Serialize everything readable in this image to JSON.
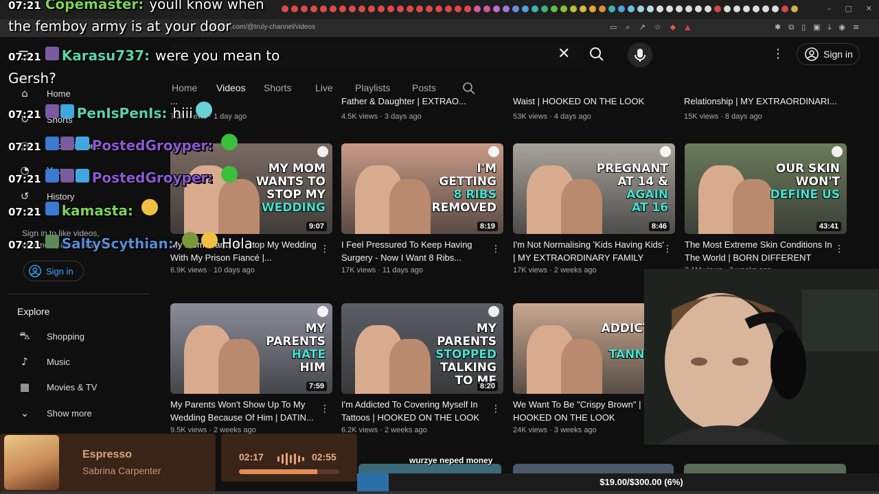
{
  "browser": {
    "url": "youtube.com/@truly-channel/videos",
    "tab_dot_colors": [
      "#e04848",
      "#e04848",
      "#e04848",
      "#e04848",
      "#e04848",
      "#e04848",
      "#e04848",
      "#e04848",
      "#e04848",
      "#e04848",
      "#e04848",
      "#e04848",
      "#e04848",
      "#e04848",
      "#e04848",
      "#e04848",
      "#e04848",
      "#e04848",
      "#e04848",
      "#e04848",
      "#d05a9a",
      "#d05a9a",
      "#c76bd0",
      "#9b7ad6",
      "#6b8be0",
      "#4fa0d8",
      "#3fb0b0",
      "#3fb07a",
      "#5fbf4a",
      "#8ac23b",
      "#b7c03a",
      "#d8b93b",
      "#e0a53b",
      "#e08a3b",
      "#3fb0b0",
      "#4fa0d8",
      "#6bc0e0",
      "#9bd0e0",
      "#c0d8e0",
      "#dcdcdc",
      "#dcdcdc",
      "#dcdcdc",
      "#dcdcdc",
      "#dcdcdc",
      "#dcdcdc",
      "#d04848",
      "#dcdcdc",
      "#dcdcdc",
      "#dcdcdc",
      "#dcdcdc",
      "#dcdcdc",
      "#dcdcdc",
      "#d04848",
      "#d0b04a"
    ]
  },
  "header": {
    "search_value": "",
    "signin_label": "Sign in"
  },
  "channel_tabs": [
    {
      "label": "Home",
      "active": false
    },
    {
      "label": "Videos",
      "active": true
    },
    {
      "label": "Shorts",
      "active": false
    },
    {
      "label": "Live",
      "active": false
    },
    {
      "label": "Playlists",
      "active": false
    },
    {
      "label": "Posts",
      "active": false
    }
  ],
  "sidebar": {
    "items": [
      {
        "label": "Home",
        "icon": "home-icon"
      },
      {
        "label": "Shorts",
        "icon": "shorts-icon"
      },
      {
        "label": "Subscriptions",
        "icon": "subscriptions-icon"
      },
      {
        "label": "You",
        "icon": "you-icon"
      },
      {
        "label": "History",
        "icon": "history-icon"
      }
    ],
    "signin_prompt": "Sign in to like videos, comment, and subscribe.",
    "signin_label": "Sign in",
    "explore_title": "Explore",
    "explore_items": [
      {
        "label": "Shopping",
        "icon": "shopping-bag-icon"
      },
      {
        "label": "Music",
        "icon": "music-note-icon"
      },
      {
        "label": "Movies & TV",
        "icon": "film-icon"
      },
      {
        "label": "Show more",
        "icon": "chevron-down-icon"
      }
    ]
  },
  "partial_row": [
    {
      "title": "...",
      "meta": "7.2K views · 1 day ago"
    },
    {
      "title": "Father & Daughter | EXTRAO...",
      "meta": "4.5K views · 3 days ago"
    },
    {
      "title": "Waist | HOOKED ON THE LOOK",
      "meta": "53K views · 4 days ago"
    },
    {
      "title": "Relationship | MY EXTRAORDINARI...",
      "meta": "15K views · 8 days ago"
    }
  ],
  "videos": [
    {
      "thumb_text": [
        "MY MOM",
        "WANTS TO",
        "STOP MY",
        "WEDDING"
      ],
      "hl": [
        3
      ],
      "duration": "9:07",
      "title": "My Mom Wants To Stop My Wedding With My Prison Fiancé |...",
      "meta": "6.9K views · 10 days ago",
      "bg": "#7a6b62"
    },
    {
      "thumb_text": [
        "I'M",
        "GETTING",
        "8 RIBS",
        "REMOVED"
      ],
      "hl": [
        2
      ],
      "duration": "8:19",
      "title": "I Feel Pressured To Keep Having Surgery - Now I Want 8 Ribs...",
      "meta": "17K views · 11 days ago",
      "bg": "#c99a86"
    },
    {
      "thumb_text": [
        "PREGNANT",
        "AT 14 &",
        "AGAIN",
        "AT 16"
      ],
      "hl": [
        2,
        3
      ],
      "duration": "8:46",
      "title": "I'm Not Normalising 'Kids Having Kids' | MY EXTRAORDINARY FAMILY",
      "meta": "17K views · 2 weeks ago",
      "bg": "#a8a39a"
    },
    {
      "thumb_text": [
        "OUR SKIN",
        "WON'T",
        "DEFINE US"
      ],
      "hl": [
        2
      ],
      "duration": "43:41",
      "title": "The Most Extreme Skin Conditions In The World | BORN DIFFERENT",
      "meta": "2.1M views · 3 weeks ago",
      "bg": "#6a7b5a"
    },
    {
      "thumb_text": [
        "MY",
        "PARENTS",
        "HATE",
        "HIM"
      ],
      "hl": [
        2
      ],
      "duration": "7:59",
      "title": "My Parents Won't Show Up To My Wedding Because Of Him | DATIN...",
      "meta": "9.5K views · 2 weeks ago",
      "bg": "#8a8c99"
    },
    {
      "thumb_text": [
        "MY",
        "PARENTS",
        "STOPPED",
        "TALKING",
        "TO ME"
      ],
      "hl": [
        2
      ],
      "duration": "8:20",
      "title": "I'm Addicted To Covering Myself In Tattoos | HOOKED ON THE LOOK",
      "meta": "6.2K views · 2 weeks ago",
      "bg": "#5a5f66"
    },
    {
      "thumb_text": [
        "ADDICTED TO",
        "TANNING"
      ],
      "hl": [
        1
      ],
      "duration": "",
      "title": "We Want To Be \"Crispy Brown\" | HOOKED ON THE LOOK",
      "meta": "24K views · 3 weeks ago",
      "bg": "#c9a78f"
    }
  ],
  "chat": [
    {
      "time": "07:21",
      "user": "Copemaster:",
      "color": "#7dd35a",
      "msg": "youll know when",
      "line2": "the femboy army is at your door"
    },
    {
      "time": "07:21",
      "user": "Karasu737:",
      "color": "#5ad3a8",
      "msg": "were you mean to",
      "line2": "Gersh?"
    },
    {
      "time": "07:21",
      "user": "PenIsPenIs:",
      "color": "#5ad3a8",
      "msg": "hiii",
      "line2": ""
    },
    {
      "time": "07:21",
      "user": "PostedGroyper:",
      "color": "#8a5ad3",
      "msg": "",
      "line2": ""
    },
    {
      "time": "07:21",
      "user": "PostedGroyper:",
      "color": "#8a5ad3",
      "msg": "",
      "line2": ""
    },
    {
      "time": "07:21",
      "user": "kamasta:",
      "color": "#7dd35a",
      "msg": "",
      "line2": ""
    },
    {
      "time": "07:21",
      "user": "SaltyScythian:",
      "color": "#5a8ad3",
      "msg": "Hola",
      "line2": ""
    }
  ],
  "music": {
    "song": "Espresso",
    "artist": "Sabrina Carpenter",
    "elapsed": "02:17",
    "total": "02:55",
    "progress": 0.78
  },
  "overlay_message": "wurzye neped money",
  "goal": {
    "text": "$19.00/$300.00 (6%)",
    "fraction": 0.06
  }
}
